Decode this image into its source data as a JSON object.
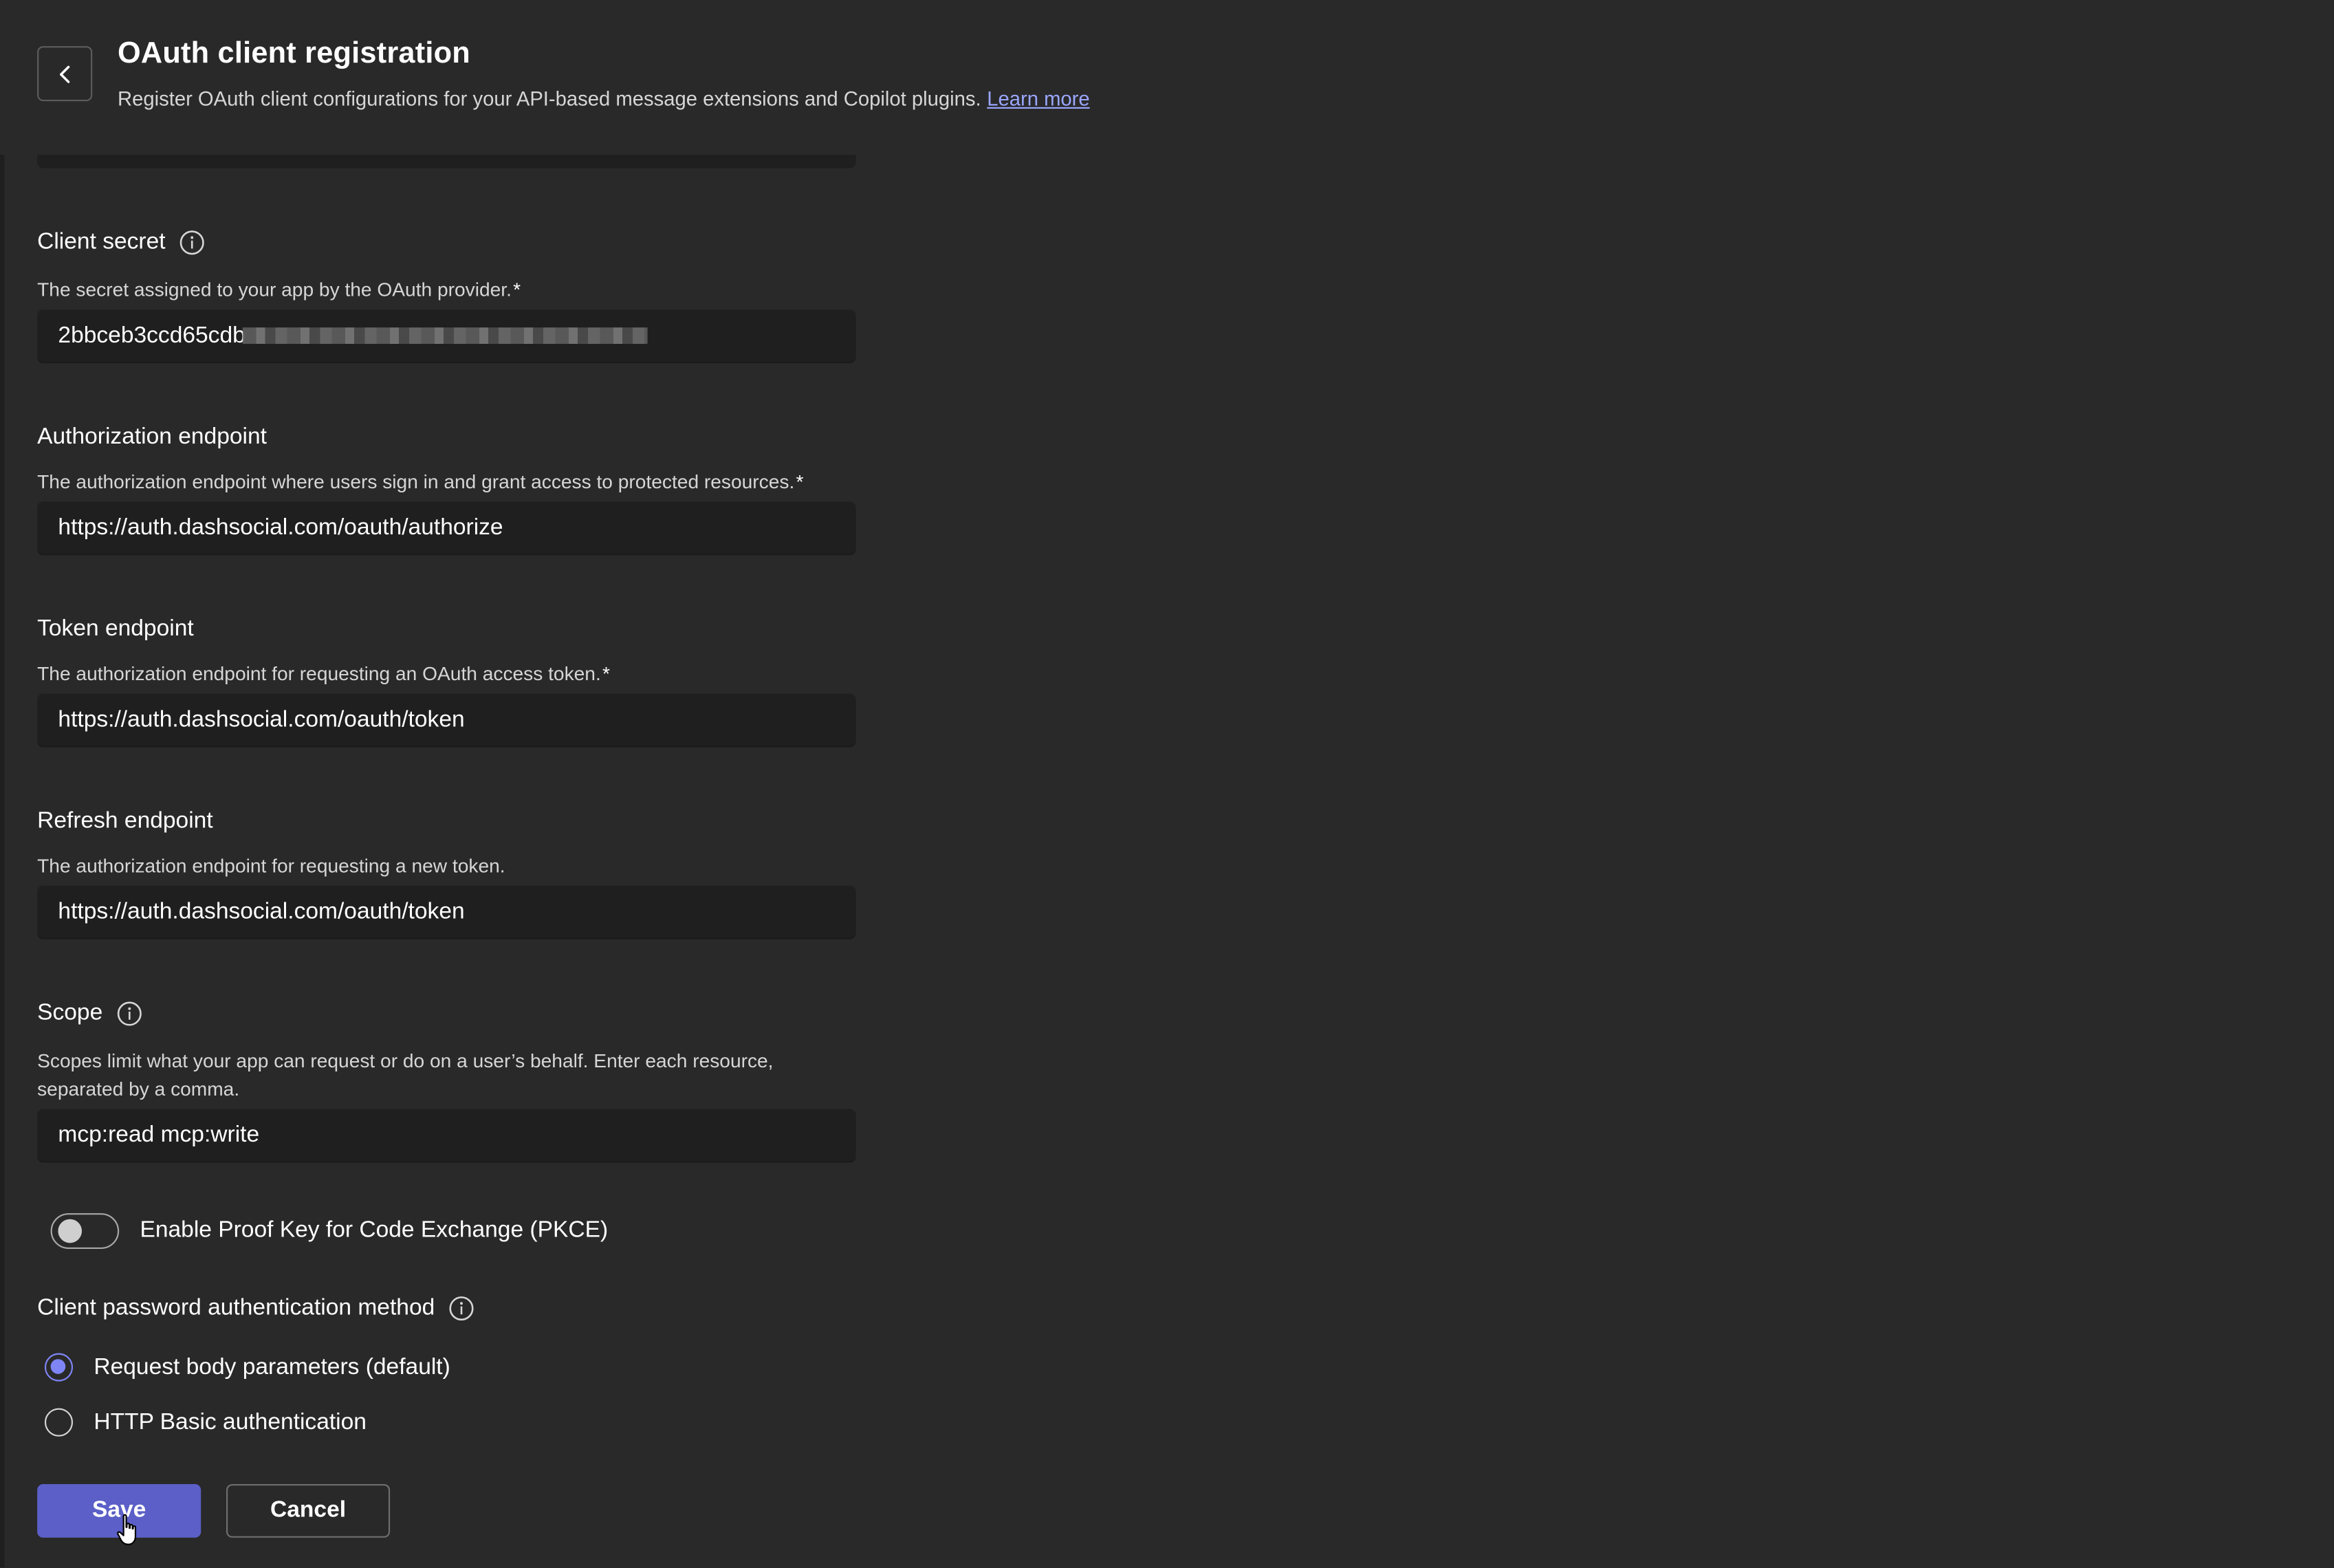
{
  "header": {
    "title": "OAuth client registration",
    "subtitle": "Register OAuth client configurations for your API-based message extensions and Copilot plugins.",
    "learn_more": "Learn more"
  },
  "fields": {
    "client_secret": {
      "label": "Client secret",
      "description": "The secret assigned to your app by the OAuth provider.",
      "required_mark": "*",
      "value": "2bbceb3ccd65cdb"
    },
    "authorization_endpoint": {
      "label": "Authorization endpoint",
      "description": "The authorization endpoint where users sign in and grant access to protected resources.",
      "required_mark": "*",
      "value": "https://auth.dashsocial.com/oauth/authorize"
    },
    "token_endpoint": {
      "label": "Token endpoint",
      "description": "The authorization endpoint for requesting an OAuth access token.",
      "required_mark": "*",
      "value": "https://auth.dashsocial.com/oauth/token"
    },
    "refresh_endpoint": {
      "label": "Refresh endpoint",
      "description": "The authorization endpoint for requesting a new token.",
      "value": "https://auth.dashsocial.com/oauth/token"
    },
    "scope": {
      "label": "Scope",
      "description": "Scopes limit what your app can request or do on a user’s behalf. Enter each resource, separated by a comma.",
      "value": "mcp:read mcp:write"
    }
  },
  "pkce": {
    "label": "Enable Proof Key for Code Exchange (PKCE)",
    "enabled": false
  },
  "auth_method": {
    "label": "Client password authentication method",
    "options": [
      {
        "label": "Request body parameters (default)",
        "selected": true
      },
      {
        "label": "HTTP Basic authentication",
        "selected": false
      }
    ]
  },
  "actions": {
    "save_label": "Save",
    "cancel_label": "Cancel"
  },
  "colors": {
    "background": "#292929",
    "input_background": "#1f1f1f",
    "accent": "#5b5fc7",
    "radio_accent": "#7f85f5",
    "link": "#9aa6ff"
  }
}
